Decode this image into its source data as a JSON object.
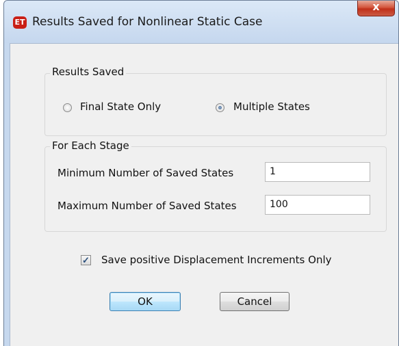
{
  "window": {
    "title": "Results Saved for Nonlinear Static Case",
    "app_icon_text": "ET",
    "close_glyph": "x"
  },
  "results_saved": {
    "group_title": "Results Saved",
    "options": [
      {
        "label": "Final State Only",
        "selected": false
      },
      {
        "label": "Multiple States",
        "selected": true
      }
    ]
  },
  "for_each_stage": {
    "group_title": "For Each Stage",
    "min_label": "Minimum Number of Saved States",
    "min_value": "1",
    "max_label": "Maximum Number of Saved States",
    "max_value": "100"
  },
  "positive_increments": {
    "label": "Save positive Displacement Increments Only",
    "checked": true,
    "check_glyph": "✓"
  },
  "buttons": {
    "ok": "OK",
    "cancel": "Cancel"
  },
  "colors": {
    "title_bar": "#c5d7ee",
    "close_button": "#c0301a",
    "dialog_background": "#f0f0f0",
    "default_button_border": "#3c7fb1"
  }
}
